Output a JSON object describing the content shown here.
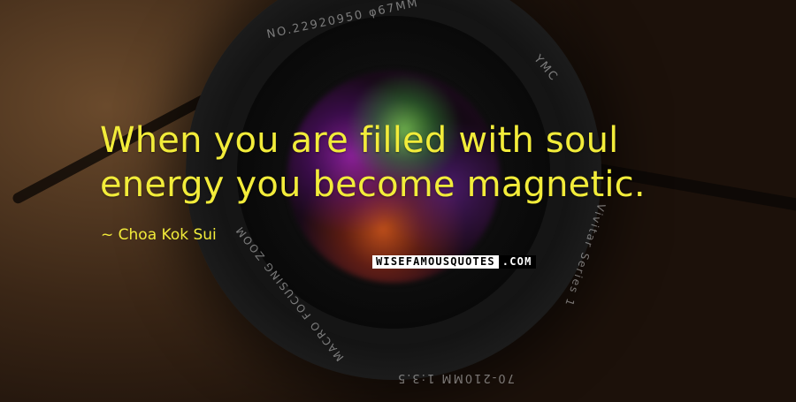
{
  "quote": {
    "line1": "When you are filled with soul",
    "line2": "energy you become magnetic."
  },
  "author": "~ Choa Kok Sui",
  "watermark": {
    "part1": "WISEFAMOUSQUOTES",
    "part2": ".COM"
  },
  "lens_markings": {
    "top": "NO.22920950   φ67MM",
    "ymc": "YMC",
    "series": "Vivitar Series 1",
    "macro": "MACRO FOCUSING ZOOM",
    "zoom": "70-210MM 1:3.5"
  },
  "colors": {
    "text": "#f2ec3a",
    "background": "#1c110a"
  }
}
